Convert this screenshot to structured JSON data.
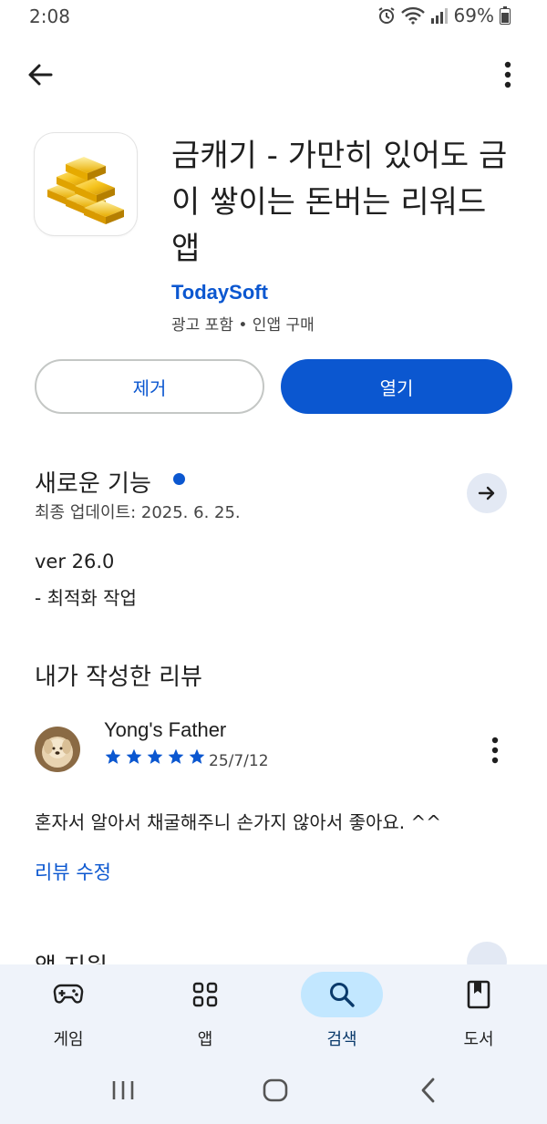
{
  "status_bar": {
    "time": "2:08",
    "battery": "69%"
  },
  "app": {
    "title": "금캐기 - 가만히 있어도 금이 쌓이는 돈버는 리워드 앱",
    "developer": "TodaySoft",
    "meta": "광고 포함 • 인앱 구매",
    "uninstall_label": "제거",
    "open_label": "열기"
  },
  "whats_new": {
    "title": "새로운 기능",
    "last_updated": "최종 업데이트: 2025. 6. 25.",
    "version": "ver 26.0",
    "note": "- 최적화 작업"
  },
  "my_review": {
    "header": "내가 작성한 리뷰",
    "reviewer": "Yong's Father",
    "rating": 5,
    "date": "25/7/12",
    "text": "혼자서 알아서 채굴해주니 손가지 않아서 좋아요. ^^",
    "edit_label": "리뷰 수정"
  },
  "next_section": {
    "title": "앱 지원"
  },
  "bottom_nav": {
    "items": [
      {
        "label": "게임",
        "icon": "gamepad-icon"
      },
      {
        "label": "앱",
        "icon": "apps-grid-icon"
      },
      {
        "label": "검색",
        "icon": "search-icon"
      },
      {
        "label": "도서",
        "icon": "book-icon"
      }
    ],
    "active": "검색"
  },
  "colors": {
    "accent": "#0b57d0",
    "nav_background": "#eff3fa",
    "active_pill": "#c2e7ff",
    "star": "#0b57d0"
  }
}
